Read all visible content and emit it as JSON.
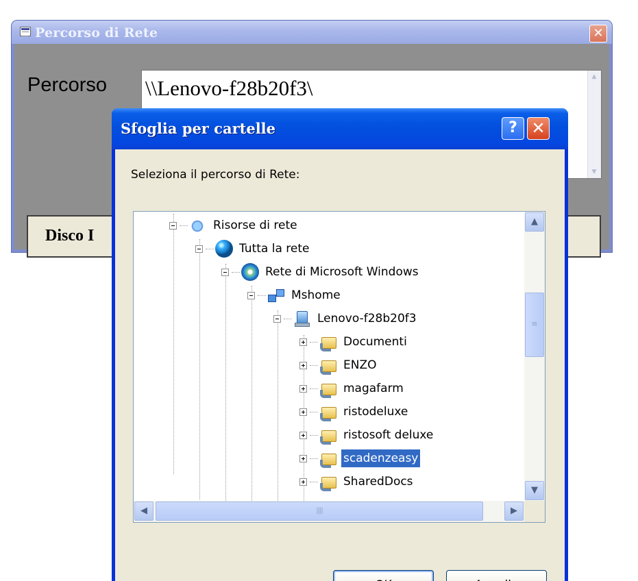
{
  "parent_window": {
    "title": "Percorso di Rete",
    "path_label": "Percorso",
    "path_value": "\\\\Lenovo-f28b20f3\\",
    "disco_button_label": "Disco I"
  },
  "dialog": {
    "title": "Sfoglia per cartelle",
    "help_glyph": "?",
    "close_glyph": "✕",
    "instruction": "Seleziona il percorso di Rete:",
    "tree": [
      {
        "label": "Risorse di rete",
        "icon": "network-places-icon",
        "expander": "minus",
        "depth": 0
      },
      {
        "label": "Tutta la rete",
        "icon": "globe-icon",
        "expander": "minus",
        "depth": 1
      },
      {
        "label": "Rete di Microsoft Windows",
        "icon": "microsoft-network-icon",
        "expander": "minus",
        "depth": 2
      },
      {
        "label": "Mshome",
        "icon": "workgroup-icon",
        "expander": "minus",
        "depth": 3
      },
      {
        "label": "Lenovo-f28b20f3",
        "icon": "computer-icon",
        "expander": "minus",
        "depth": 4
      },
      {
        "label": "Documenti",
        "icon": "shared-folder-icon",
        "expander": "plus",
        "depth": 5
      },
      {
        "label": "ENZO",
        "icon": "shared-folder-icon",
        "expander": "plus",
        "depth": 5
      },
      {
        "label": "magafarm",
        "icon": "shared-folder-icon",
        "expander": "plus",
        "depth": 5
      },
      {
        "label": "ristodeluxe",
        "icon": "shared-folder-icon",
        "expander": "plus",
        "depth": 5
      },
      {
        "label": "ristosoft deluxe",
        "icon": "shared-folder-icon",
        "expander": "plus",
        "depth": 5
      },
      {
        "label": "scadenzeasy",
        "icon": "shared-folder-icon",
        "expander": "plus",
        "depth": 5,
        "selected": true
      },
      {
        "label": "SharedDocs",
        "icon": "shared-folder-icon",
        "expander": "plus",
        "depth": 5
      }
    ],
    "ok_label": "OK",
    "cancel_label": "Annulla"
  },
  "colors": {
    "selection": "#316ac5",
    "dialog_title": "#0350de",
    "parent_title": "#a9b7ea"
  }
}
